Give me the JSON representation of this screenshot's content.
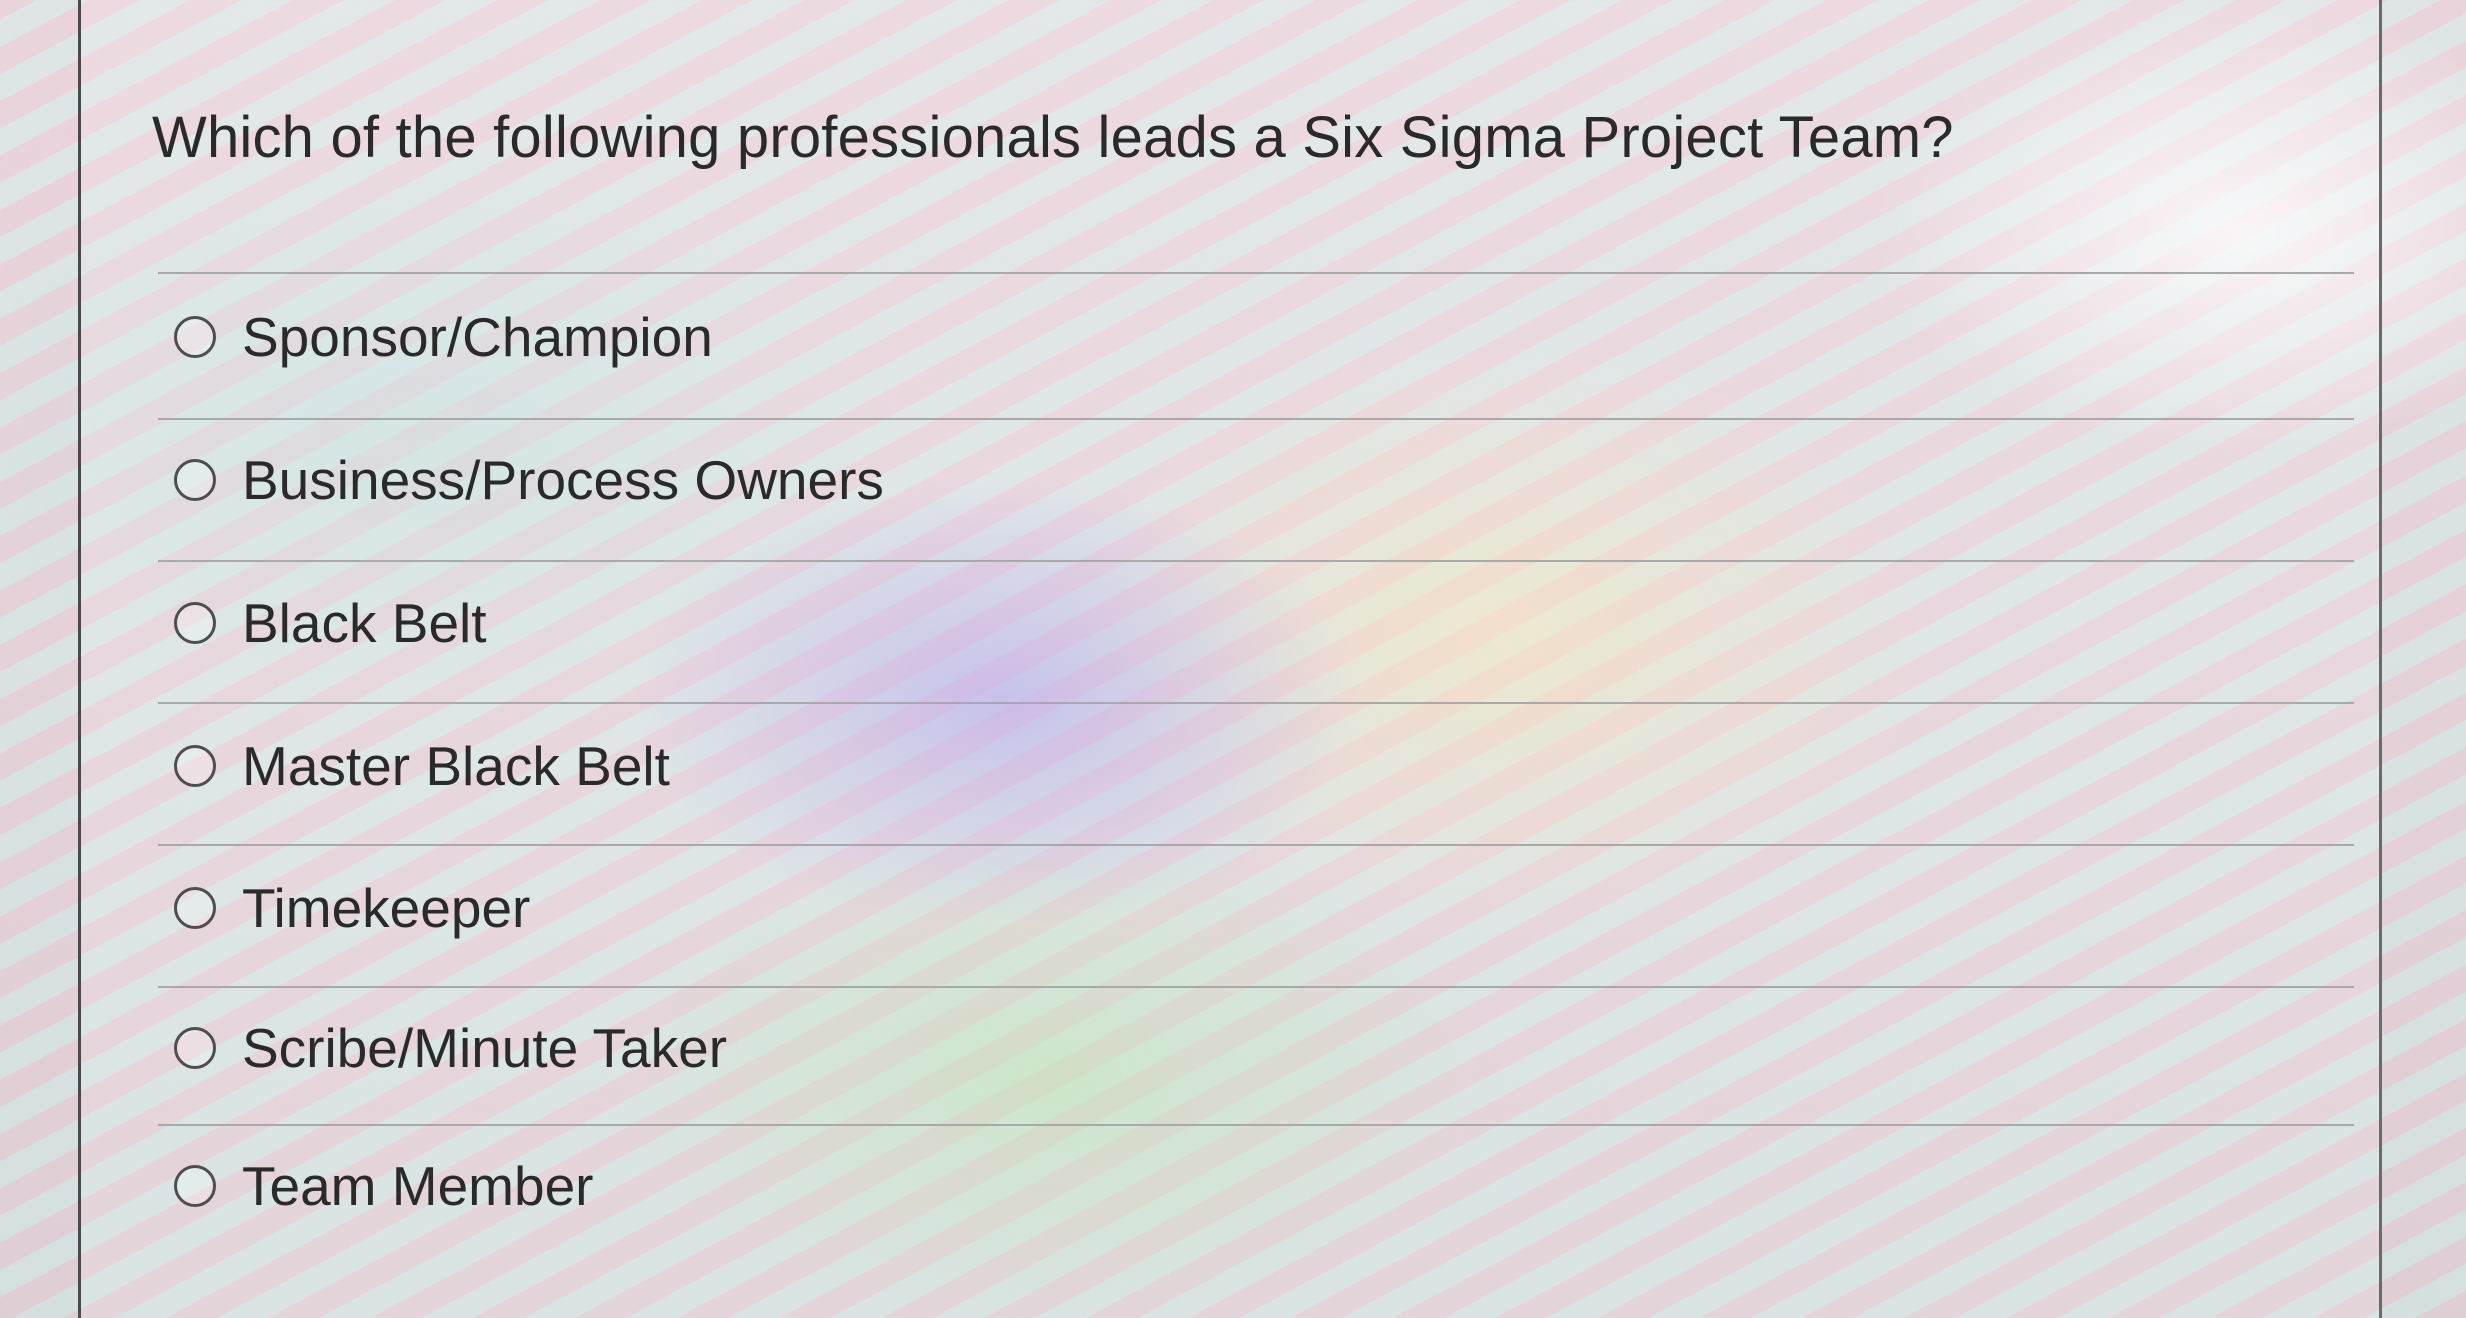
{
  "question": {
    "text": "Which of the following professionals leads a Six Sigma Project Team?"
  },
  "options": [
    {
      "label": "Sponsor/Champion",
      "selected": false
    },
    {
      "label": "Business/Process Owners",
      "selected": false
    },
    {
      "label": "Black Belt",
      "selected": false
    },
    {
      "label": "Master Black Belt",
      "selected": false
    },
    {
      "label": "Timekeeper",
      "selected": false
    },
    {
      "label": "Scribe/Minute Taker",
      "selected": false
    },
    {
      "label": "Team Member",
      "selected": false
    }
  ],
  "colors": {
    "text": "#2a2a2a",
    "divider": "#a9a9a9",
    "radio_border": "#4e4e4e"
  },
  "icons": {
    "radio": "radio-unchecked-icon"
  }
}
